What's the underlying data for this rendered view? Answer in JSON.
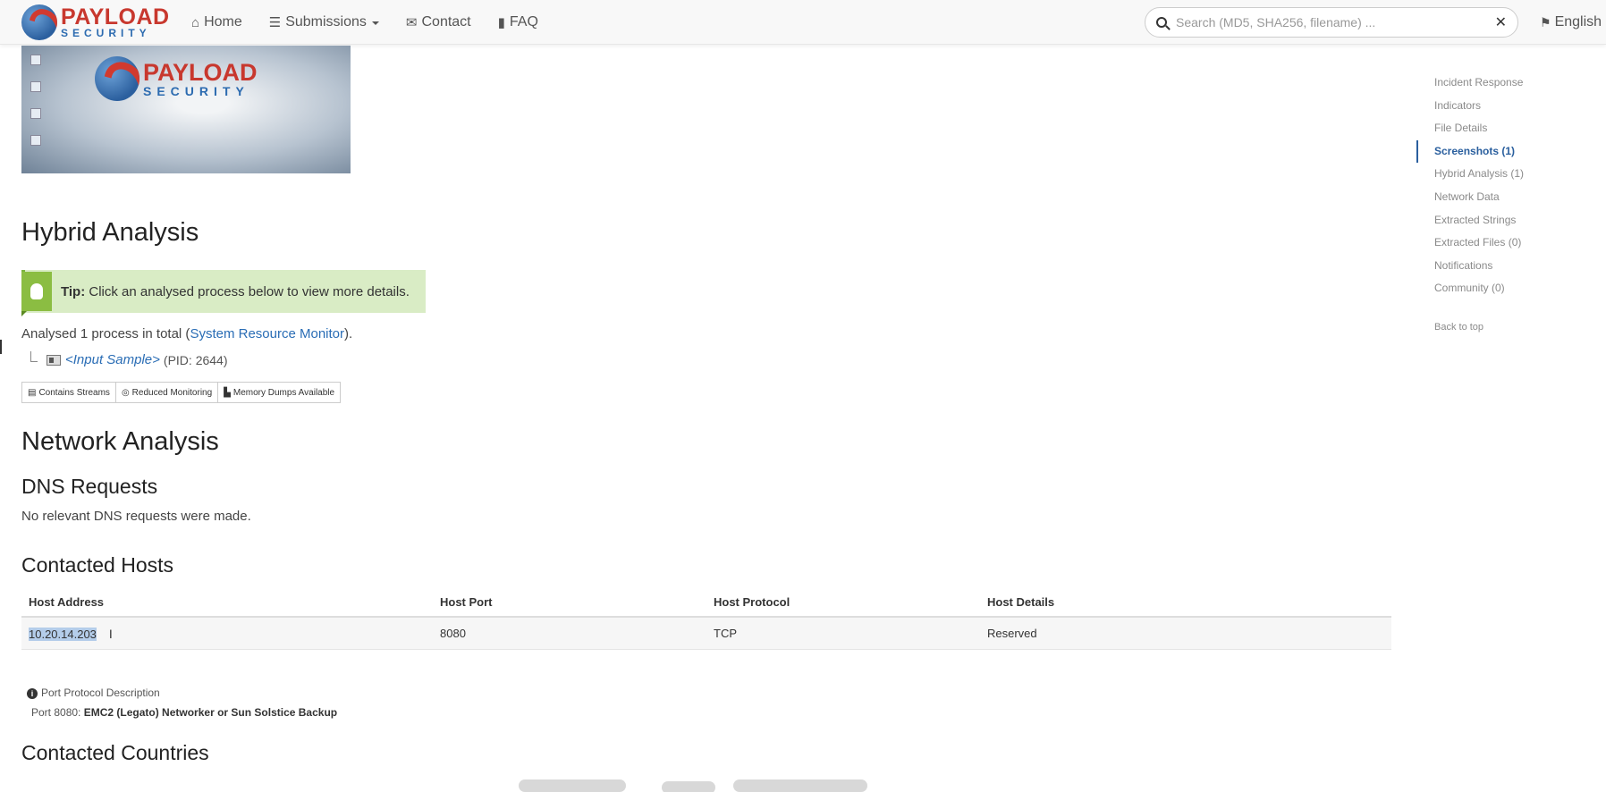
{
  "navbar": {
    "brand_top": "PAYLOAD",
    "brand_bottom": "SECURITY",
    "items": [
      {
        "label": "Home",
        "icon": "home-icon"
      },
      {
        "label": "Submissions",
        "icon": "list-icon"
      },
      {
        "label": "Contact",
        "icon": "envelope-icon"
      },
      {
        "label": "FAQ",
        "icon": "book-icon"
      }
    ],
    "search_placeholder": "Search (MD5, SHA256, filename) ...",
    "language": "English"
  },
  "screenshot": {
    "logo_top": "PAYLOAD",
    "logo_bottom": "SECURITY"
  },
  "hybrid": {
    "title": "Hybrid Analysis",
    "tip_label": "Tip:",
    "tip_text": "Click an analysed process below to view more details.",
    "summary_prefix": "Analysed 1 process in total (",
    "summary_link": "System Resource Monitor",
    "summary_suffix": ").",
    "process_name": "<Input Sample>",
    "process_pid": "(PID: 2644)",
    "badges": [
      "Contains Streams",
      "Reduced Monitoring",
      "Memory Dumps Available"
    ]
  },
  "network": {
    "title": "Network Analysis",
    "dns_title": "DNS Requests",
    "dns_text": "No relevant DNS requests were made.",
    "hosts_title": "Contacted Hosts",
    "columns": [
      "Host Address",
      "Host Port",
      "Host Protocol",
      "Host Details"
    ],
    "rows": [
      {
        "address": "10.20.14.203",
        "port": "8080",
        "protocol": "TCP",
        "details": "Reserved"
      }
    ],
    "port_desc_label": "Port Protocol Description",
    "port_desc_prefix": "Port 8080: ",
    "port_desc_value": "EMC2 (Legato) Networker or Sun Solstice Backup",
    "countries_title": "Contacted Countries"
  },
  "sidebar": {
    "items": [
      {
        "label": "Incident Response",
        "active": false
      },
      {
        "label": "Indicators",
        "active": false
      },
      {
        "label": "File Details",
        "active": false
      },
      {
        "label": "Screenshots (1)",
        "active": true
      },
      {
        "label": "Hybrid Analysis (1)",
        "active": false
      },
      {
        "label": "Network Data",
        "active": false
      },
      {
        "label": "Extracted Strings",
        "active": false
      },
      {
        "label": "Extracted Files (0)",
        "active": false
      },
      {
        "label": "Notifications",
        "active": false
      },
      {
        "label": "Community (0)",
        "active": false
      }
    ],
    "back_to_top": "Back to top"
  },
  "colors": {
    "accent": "#2a6db5",
    "tip_bg": "#d9ecc5",
    "brand_red": "#c8382e",
    "brand_blue": "#2c6bb0"
  }
}
